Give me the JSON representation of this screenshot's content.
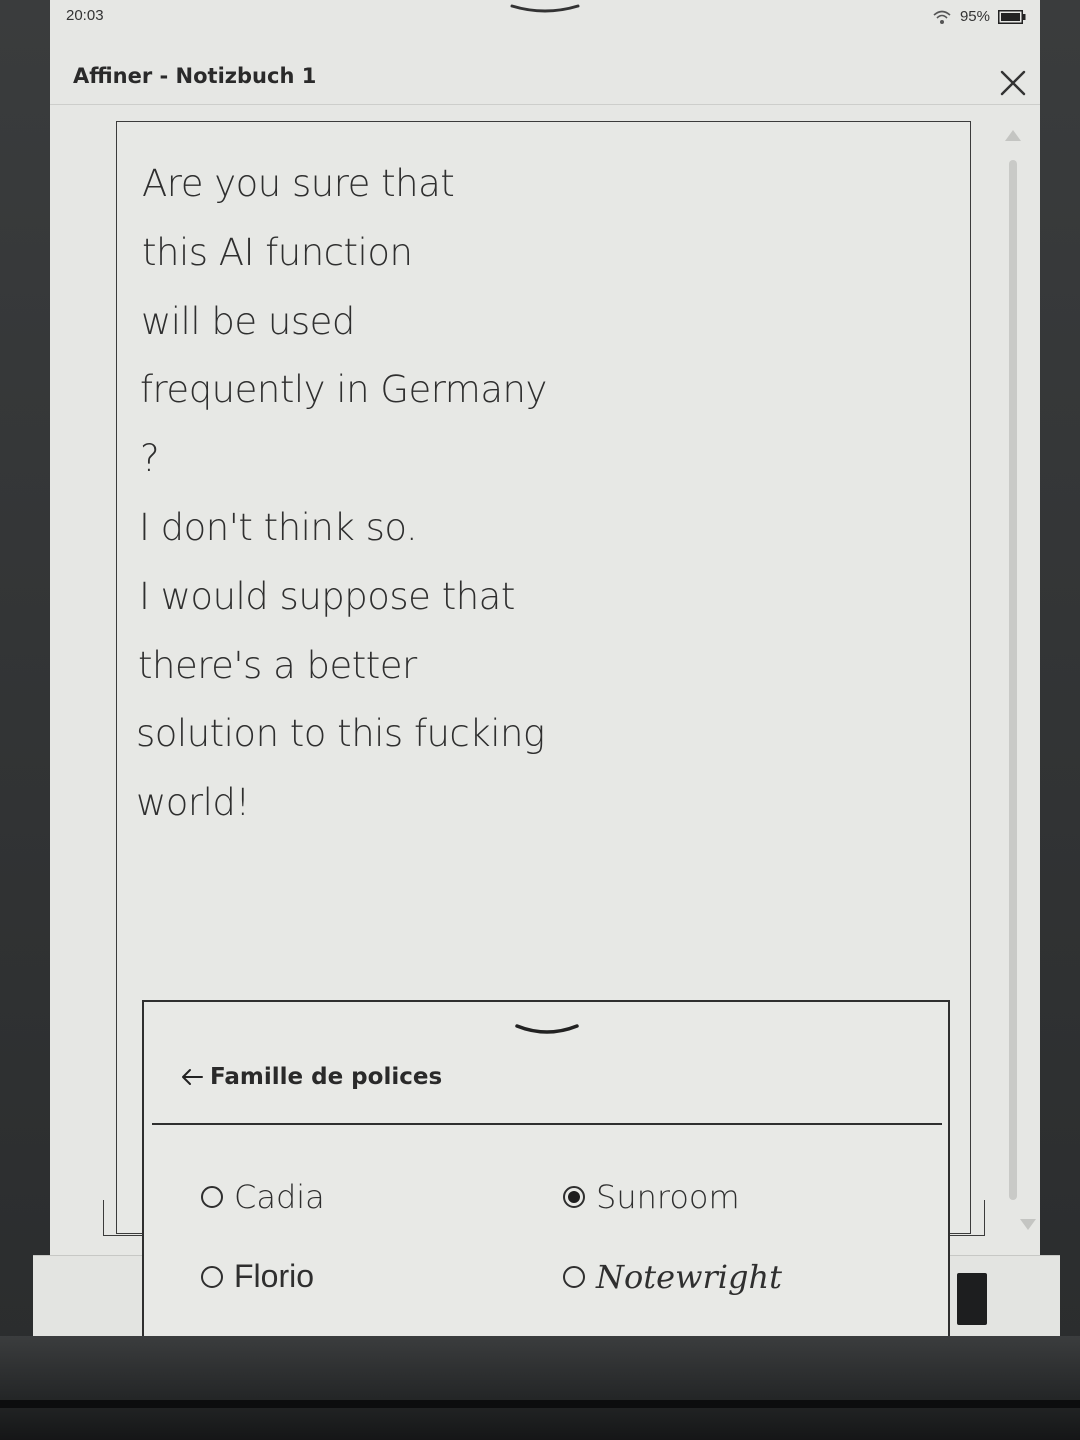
{
  "status_bar": {
    "time": "20:03",
    "battery": "95%",
    "icons": [
      "wifi-icon",
      "battery-icon"
    ]
  },
  "header": {
    "title": "Affiner - Notizbuch 1",
    "close_icon": "close-icon"
  },
  "note": {
    "lines": [
      "Are you sure that",
      "this AI function",
      "will be used",
      "frequently in Germany",
      "?",
      "I don't think so.",
      "I would suppose that",
      "there's a better",
      "solution to this fucking",
      "world!"
    ]
  },
  "font_sheet": {
    "title": "Famille de polices",
    "back_icon": "back-arrow-icon",
    "collapse_icon": "chevron-down-icon",
    "options": [
      {
        "label": "Cadia",
        "selected": false
      },
      {
        "label": "Sunroom",
        "selected": true
      },
      {
        "label": "Florio",
        "selected": false
      },
      {
        "label": "Notewright",
        "selected": false
      }
    ]
  },
  "colors": {
    "screen_background": "#e6e7e4",
    "ink": "#2f2f2f",
    "bezel": "#2b2d2e"
  }
}
